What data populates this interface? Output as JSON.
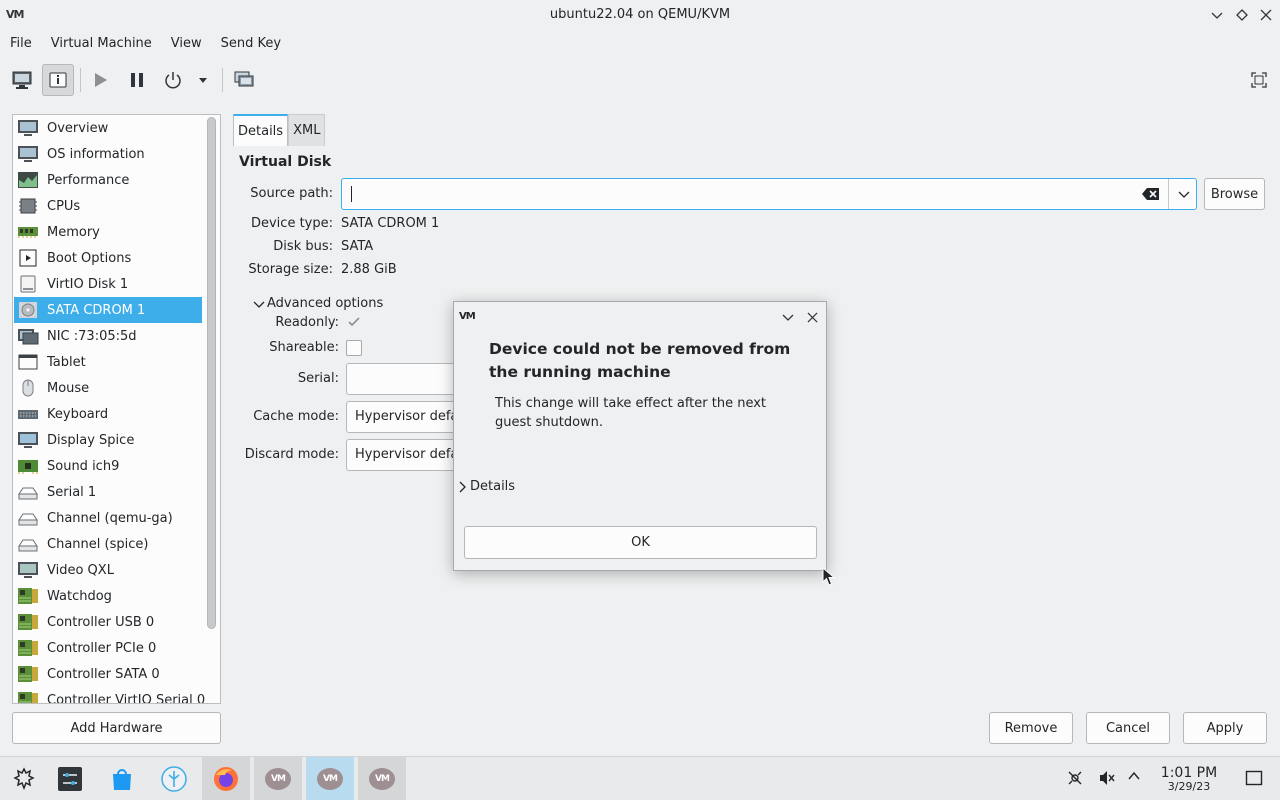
{
  "window": {
    "logo_text": "VM",
    "title": "ubuntu22.04 on QEMU/KVM"
  },
  "menu": [
    "File",
    "Virtual Machine",
    "View",
    "Send Key"
  ],
  "sidebar": {
    "selected_index": 7,
    "items": [
      {
        "label": "Overview",
        "icon": "monitor-icon"
      },
      {
        "label": "OS information",
        "icon": "monitor-icon"
      },
      {
        "label": "Performance",
        "icon": "performance-chart-icon"
      },
      {
        "label": "CPUs",
        "icon": "cpu-chip-icon"
      },
      {
        "label": "Memory",
        "icon": "memory-module-icon"
      },
      {
        "label": "Boot Options",
        "icon": "boot-options-icon"
      },
      {
        "label": "VirtIO Disk 1",
        "icon": "hard-disk-icon"
      },
      {
        "label": "SATA CDROM 1",
        "icon": "cdrom-icon"
      },
      {
        "label": "NIC :73:05:5d",
        "icon": "network-card-icon"
      },
      {
        "label": "Tablet",
        "icon": "tablet-icon"
      },
      {
        "label": "Mouse",
        "icon": "mouse-icon"
      },
      {
        "label": "Keyboard",
        "icon": "keyboard-icon"
      },
      {
        "label": "Display Spice",
        "icon": "display-icon"
      },
      {
        "label": "Sound ich9",
        "icon": "sound-card-icon"
      },
      {
        "label": "Serial 1",
        "icon": "serial-port-icon"
      },
      {
        "label": "Channel (qemu-ga)",
        "icon": "channel-icon"
      },
      {
        "label": "Channel (spice)",
        "icon": "channel-icon"
      },
      {
        "label": "Video QXL",
        "icon": "video-card-icon"
      },
      {
        "label": "Watchdog",
        "icon": "controller-icon"
      },
      {
        "label": "Controller USB 0",
        "icon": "controller-icon"
      },
      {
        "label": "Controller PCIe 0",
        "icon": "controller-icon"
      },
      {
        "label": "Controller SATA 0",
        "icon": "controller-icon"
      },
      {
        "label": "Controller VirtIO Serial 0",
        "icon": "controller-icon"
      }
    ],
    "add_hardware": "Add Hardware"
  },
  "tabs": [
    "Details",
    "XML"
  ],
  "details": {
    "section_title": "Virtual Disk",
    "source_path": {
      "label": "Source path:",
      "value": ""
    },
    "browse": "Browse",
    "device_type": {
      "label": "Device type:",
      "value": "SATA CDROM 1"
    },
    "disk_bus": {
      "label": "Disk bus:",
      "value": "SATA"
    },
    "storage_size": {
      "label": "Storage size:",
      "value": "2.88 GiB"
    },
    "advanced": "Advanced options",
    "readonly": {
      "label": "Readonly:",
      "checked": true
    },
    "shareable": {
      "label": "Shareable:",
      "checked": false
    },
    "serial": {
      "label": "Serial:",
      "value": ""
    },
    "cache_mode": {
      "label": "Cache mode:",
      "value": "Hypervisor defa"
    },
    "discard_mode": {
      "label": "Discard mode:",
      "value": "Hypervisor defa"
    }
  },
  "footer_buttons": {
    "remove": "Remove",
    "cancel": "Cancel",
    "apply": "Apply"
  },
  "dialog": {
    "logo_text": "VM",
    "heading": "Device could not be removed from the running machine",
    "message": "This change will take effect after the next guest shutdown.",
    "details": "Details",
    "ok": "OK"
  },
  "taskbar": {
    "apps": [
      "app-launcher-icon",
      "system-settings-icon",
      "discover-store-icon",
      "kde-connect-icon",
      "firefox-icon",
      "virt-manager-icon",
      "virt-manager-icon",
      "virt-manager-icon"
    ],
    "time": "1:01 PM",
    "date": "3/29/23"
  },
  "colors": {
    "accent": "#3daee9",
    "background": "#eff0f1",
    "field": "#fcfcfc"
  }
}
